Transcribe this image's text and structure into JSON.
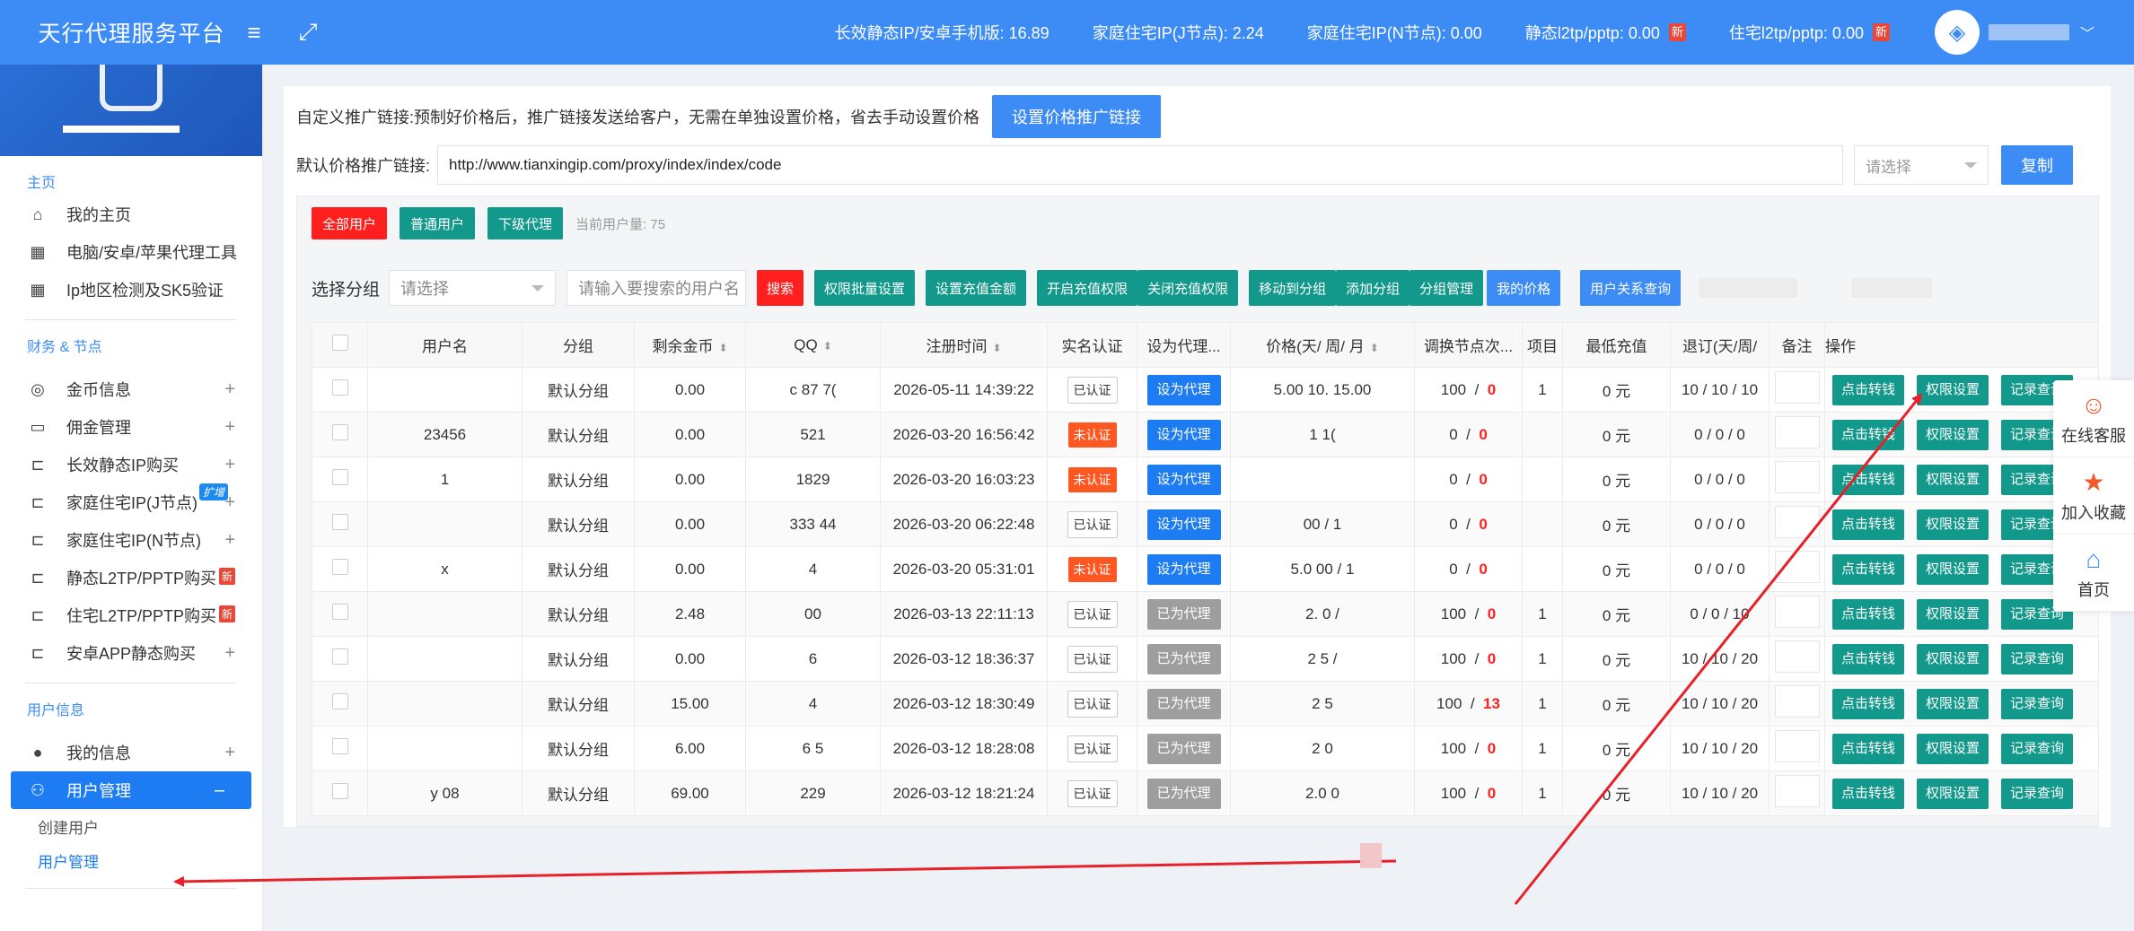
{
  "header": {
    "brand": "天行代理服务平台",
    "menu_icon": "menu-icon",
    "fullscreen_icon": "fullscreen-icon",
    "stats": [
      {
        "label": "长效静态IP/安卓手机版: 16.89",
        "new": ""
      },
      {
        "label": "家庭住宅IP(J节点): 2.24",
        "new": ""
      },
      {
        "label": "家庭住宅IP(N节点): 0.00",
        "new": ""
      },
      {
        "label": "静态l2tp/pptp: 0.00",
        "new": "新"
      },
      {
        "label": "住宅l2tp/pptp: 0.00",
        "new": "新"
      }
    ],
    "user_avatar": "avatar-logo"
  },
  "sidebar": {
    "sections": {
      "home": "主页",
      "finance": "财务 & 节点",
      "user": "用户信息"
    },
    "home_items": [
      {
        "label": "我的主页",
        "icon": "home-icon"
      },
      {
        "label": "电脑/安卓/苹果代理工具",
        "icon": "grid-icon"
      },
      {
        "label": "Ip地区检测及SK5验证",
        "icon": "grid-icon"
      }
    ],
    "finance_items": [
      {
        "label": "金币信息",
        "icon": "coin-icon",
        "plus": "+"
      },
      {
        "label": "佣金管理",
        "icon": "card-icon",
        "plus": "+"
      },
      {
        "label": "长效静态IP购买",
        "icon": "tree-icon",
        "plus": "+"
      },
      {
        "label": "家庭住宅IP(J节点)",
        "icon": "tree-icon",
        "plus": "+",
        "tag_blue": "扩增"
      },
      {
        "label": "家庭住宅IP(N节点)",
        "icon": "tree-icon",
        "plus": "+"
      },
      {
        "label": "静态L2TP/PPTP购买",
        "icon": "tree-icon",
        "tag": "新"
      },
      {
        "label": "住宅L2TP/PPTP购买",
        "icon": "tree-icon",
        "tag": "新"
      },
      {
        "label": "安卓APP静态购买",
        "icon": "tree-icon",
        "plus": "+"
      }
    ],
    "user_items": [
      {
        "label": "我的信息",
        "icon": "person-icon",
        "plus": "+"
      },
      {
        "label": "用户管理",
        "icon": "users-icon",
        "plus": "–"
      }
    ],
    "sub_items": [
      "创建用户",
      "用户管理"
    ]
  },
  "main": {
    "promo_text": "自定义推广链接:预制好价格后，推广链接发送给客户，无需在单独设置价格，省去手动设置价格",
    "promo_button": "设置价格推广链接",
    "link_label": "默认价格推广链接:",
    "link_value": "http://www.tianxingip.com/proxy/index/index/code",
    "link_select_placeholder": "请选择",
    "copy_button": "复制",
    "tabs": [
      "全部用户",
      "普通用户",
      "下级代理"
    ],
    "current_count": "当前用户量: 75",
    "group_label": "选择分组",
    "group_placeholder": "请选择",
    "search_placeholder": "请输入要搜索的用户名",
    "buttons": {
      "search": "搜索",
      "batch": "权限批量设置",
      "recharge_amount": "设置充值金额",
      "enable_recharge": "开启充值权限",
      "disable_recharge": "关闭充值权限",
      "move_group": "移动到分组",
      "add_group": "添加分组",
      "group_manage": "分组管理",
      "my_price": "我的价格",
      "relation": "用户关系查询"
    },
    "table": {
      "headers": [
        "用户名",
        "分组",
        "剩余金币",
        "QQ",
        "注册时间",
        "实名认证",
        "设为代理...",
        "价格(天/ 周/ 月",
        "调换节点次...",
        "项目",
        "最低充值",
        "退订(天/周/",
        "备注",
        "操作"
      ],
      "rows": [
        {
          "user": "",
          "group": "默认分组",
          "coins": "0.00",
          "qq": "c 87 7(",
          "time": "2026-05-11 14:39:22",
          "auth": "已认证",
          "auth_ok": true,
          "agent": "设为代理",
          "agent_set": true,
          "price": "5.00  10.  15.00",
          "swap_a": "100",
          "swap_b": "0",
          "item": "1",
          "min": "0 元",
          "unsub": "10 / 10 / 10"
        },
        {
          "user": "23456",
          "group": "默认分组",
          "coins": "0.00",
          "qq": "521",
          "time": "2026-03-20 16:56:42",
          "auth": "未认证",
          "auth_ok": false,
          "agent": "设为代理",
          "agent_set": true,
          "price": "1   1(",
          "swap_a": "0",
          "swap_b": "0",
          "item": "",
          "min": "0 元",
          "unsub": "0 / 0 / 0"
        },
        {
          "user": "1",
          "group": "默认分组",
          "coins": "0.00",
          "qq": "1829",
          "time": "2026-03-20 16:03:23",
          "auth": "未认证",
          "auth_ok": false,
          "agent": "设为代理",
          "agent_set": true,
          "price": "",
          "swap_a": "0",
          "swap_b": "0",
          "item": "",
          "min": "0 元",
          "unsub": "0 / 0 / 0"
        },
        {
          "user": "",
          "group": "默认分组",
          "coins": "0.00",
          "qq": "333  44",
          "time": "2026-03-20 06:22:48",
          "auth": "已认证",
          "auth_ok": true,
          "agent": "设为代理",
          "agent_set": true,
          "price": "00 / 1",
          "swap_a": "0",
          "swap_b": "0",
          "item": "",
          "min": "0 元",
          "unsub": "0 / 0 / 0"
        },
        {
          "user": "x",
          "group": "默认分组",
          "coins": "0.00",
          "qq": "4",
          "time": "2026-03-20 05:31:01",
          "auth": "未认证",
          "auth_ok": false,
          "agent": "设为代理",
          "agent_set": true,
          "price": "5.0  00 / 1",
          "swap_a": "0",
          "swap_b": "0",
          "item": "",
          "min": "0 元",
          "unsub": "0 / 0 / 0"
        },
        {
          "user": "",
          "group": "默认分组",
          "coins": "2.48",
          "qq": "00",
          "time": "2026-03-13 22:11:13",
          "auth": "已认证",
          "auth_ok": true,
          "agent": "已为代理",
          "agent_set": false,
          "price": "2.  0 /",
          "swap_a": "100",
          "swap_b": "0",
          "item": "1",
          "min": "0 元",
          "unsub": "0 / 0 / 10"
        },
        {
          "user": "",
          "group": "默认分组",
          "coins": "0.00",
          "qq": "6",
          "time": "2026-03-12 18:36:37",
          "auth": "已认证",
          "auth_ok": true,
          "agent": "已为代理",
          "agent_set": false,
          "price": "2   5 /",
          "swap_a": "100",
          "swap_b": "0",
          "item": "1",
          "min": "0 元",
          "unsub": "10 / 10 / 20"
        },
        {
          "user": "",
          "group": "默认分组",
          "coins": "15.00",
          "qq": "4",
          "time": "2026-03-12 18:30:49",
          "auth": "已认证",
          "auth_ok": true,
          "agent": "已为代理",
          "agent_set": false,
          "price": "2   5",
          "swap_a": "100",
          "swap_b": "13",
          "item": "1",
          "min": "0 元",
          "unsub": "10 / 10 / 20"
        },
        {
          "user": "",
          "group": "默认分组",
          "coins": "6.00",
          "qq": "6  5",
          "time": "2026-03-12 18:28:08",
          "auth": "已认证",
          "auth_ok": true,
          "agent": "已为代理",
          "agent_set": false,
          "price": "2   0",
          "swap_a": "100",
          "swap_b": "0",
          "item": "1",
          "min": "0 元",
          "unsub": "10 / 10 / 20"
        },
        {
          "user": "y 08",
          "group": "默认分组",
          "coins": "69.00",
          "qq": "229",
          "time": "2026-03-12 18:21:24",
          "auth": "已认证",
          "auth_ok": true,
          "agent": "已为代理",
          "agent_set": false,
          "price": "2.0  0",
          "swap_a": "100",
          "swap_b": "0",
          "item": "1",
          "min": "0 元",
          "unsub": "10 / 10 / 20"
        }
      ],
      "op_buttons": [
        "点击转钱",
        "权限设置",
        "记录查询"
      ]
    }
  },
  "float_bar": [
    {
      "label": "在线客服",
      "icon": "support-icon"
    },
    {
      "label": "加入收藏",
      "icon": "star-icon"
    },
    {
      "label": "首页",
      "icon": "home-icon"
    }
  ]
}
